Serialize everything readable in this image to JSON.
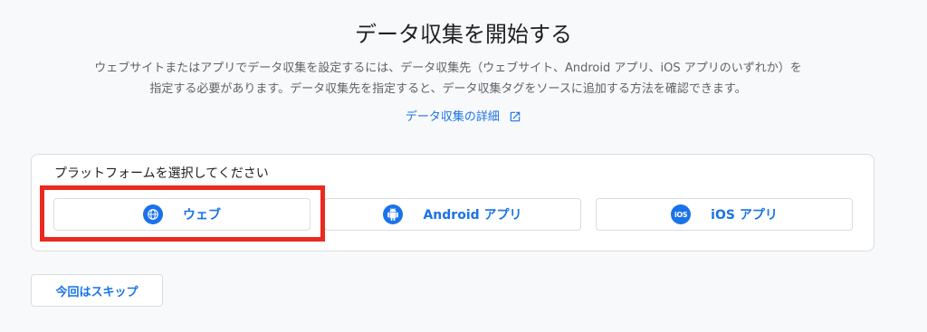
{
  "header": {
    "title": "データ収集を開始する",
    "description": "ウェブサイトまたはアプリでデータ収集を設定するには、データ収集先（ウェブサイト、Android アプリ、iOS アプリのいずれか）を指定する必要があります。データ収集先を指定すると、データ収集タグをソースに追加する方法を確認できます。",
    "learn_more_label": "データ収集の詳細"
  },
  "platform_card": {
    "label": "プラットフォームを選択してください",
    "options": [
      {
        "label": "ウェブ",
        "icon": "globe-icon"
      },
      {
        "label": "Android アプリ",
        "icon": "android-icon"
      },
      {
        "label": "iOS アプリ",
        "icon": "ios-icon"
      }
    ]
  },
  "footer": {
    "skip_label": "今回はスキップ"
  },
  "colors": {
    "accent": "#1a73e8",
    "highlight": "#ea2a1f",
    "background": "#f8f9fa",
    "border": "#dadce0"
  }
}
